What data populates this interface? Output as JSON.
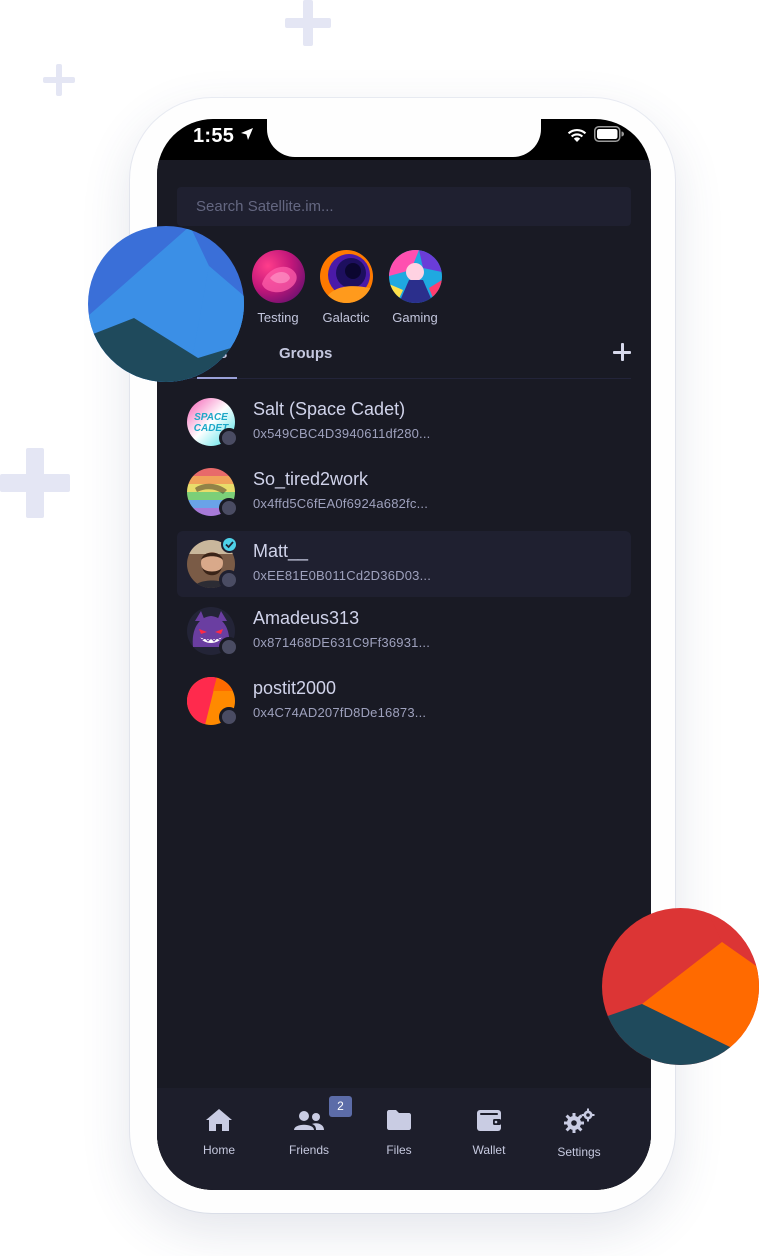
{
  "status_bar": {
    "time": "1:55"
  },
  "search": {
    "placeholder": "Search Satellite.im..."
  },
  "servers": [
    {
      "label": "Testing"
    },
    {
      "label": "Galactic"
    },
    {
      "label": "Gaming"
    }
  ],
  "tabs": {
    "friends_partial": "s",
    "groups": "Groups"
  },
  "friends": [
    {
      "name": "Salt (Space Cadet)",
      "address": "0x549CBC4D3940611df280...",
      "avatar_text": "SPACE CADET"
    },
    {
      "name": "So_tired2work",
      "address": "0x4ffd5C6fEA0f6924a682fc..."
    },
    {
      "name": "Matt__",
      "address": "0xEE81E0B011Cd2D36D03...",
      "verified": true
    },
    {
      "name": "Amadeus313",
      "address": "0x871468DE631C9Ff36931..."
    },
    {
      "name": "postit2000",
      "address": "0x4C74AD207fD8De16873..."
    }
  ],
  "bottom_nav": {
    "home": "Home",
    "friends": "Friends",
    "friends_badge": "2",
    "files": "Files",
    "wallet": "Wallet",
    "settings": "Settings"
  },
  "colors": {
    "app_background": "#191a24",
    "panel": "#1f2030",
    "badge": "#5c6ca8",
    "accent_blue": "#3a6fd8",
    "accent_red": "#dc3535",
    "accent_orange": "#ff6a00"
  }
}
